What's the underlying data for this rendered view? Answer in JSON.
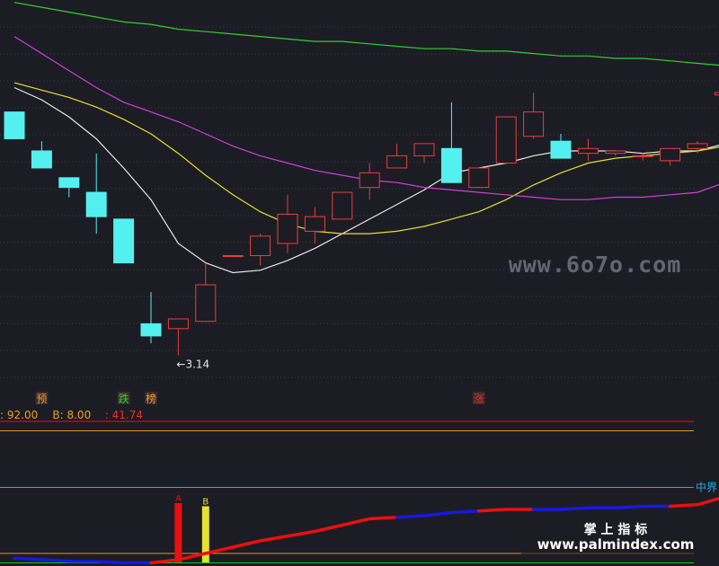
{
  "colors": {
    "background": "#1c1c24",
    "grid": "#3a3a48",
    "up": "#e8403a",
    "down": "#54f0f0",
    "ma_white": "#e8e8e8",
    "ma_yellow": "#e8e030",
    "ma_magenta": "#d040d8",
    "ma_green": "#30d030",
    "indicator_red": "#e81010",
    "indicator_blue": "#1818e0",
    "level_cyan": "#2aa8e8",
    "level_orange": "#e89030",
    "level_green": "#20c020",
    "text_orange": "#e8a030",
    "text_red": "#e83030"
  },
  "chart_data": [
    {
      "type": "candlestick",
      "grid": true,
      "ylim": [
        3.05,
        4.6
      ],
      "candles": [
        {
          "o": 4.14,
          "h": 4.14,
          "l": 4.03,
          "c": 4.03
        },
        {
          "o": 3.98,
          "h": 4.02,
          "l": 3.91,
          "c": 3.91
        },
        {
          "o": 3.87,
          "h": 3.87,
          "l": 3.79,
          "c": 3.83
        },
        {
          "o": 3.81,
          "h": 3.97,
          "l": 3.64,
          "c": 3.71
        },
        {
          "o": 3.7,
          "h": 3.7,
          "l": 3.52,
          "c": 3.52
        },
        {
          "o": 3.27,
          "h": 3.4,
          "l": 3.19,
          "c": 3.22
        },
        {
          "o": 3.25,
          "h": 3.25,
          "l": 3.14,
          "c": 3.29
        },
        {
          "o": 3.28,
          "h": 3.52,
          "l": 3.28,
          "c": 3.43
        },
        {
          "o": 3.55,
          "h": 3.55,
          "l": 3.55,
          "c": 3.55
        },
        {
          "o": 3.55,
          "h": 3.64,
          "l": 3.51,
          "c": 3.63
        },
        {
          "o": 3.6,
          "h": 3.8,
          "l": 3.56,
          "c": 3.72
        },
        {
          "o": 3.65,
          "h": 3.75,
          "l": 3.6,
          "c": 3.71
        },
        {
          "o": 3.7,
          "h": 3.8,
          "l": 3.7,
          "c": 3.81
        },
        {
          "o": 3.83,
          "h": 3.93,
          "l": 3.78,
          "c": 3.89
        },
        {
          "o": 3.91,
          "h": 4.01,
          "l": 3.91,
          "c": 3.96
        },
        {
          "o": 3.96,
          "h": 4.0,
          "l": 3.93,
          "c": 4.01
        },
        {
          "o": 3.99,
          "h": 4.18,
          "l": 3.85,
          "c": 3.85
        },
        {
          "o": 3.83,
          "h": 3.91,
          "l": 3.83,
          "c": 3.91
        },
        {
          "o": 3.93,
          "h": 4.11,
          "l": 3.93,
          "c": 4.12
        },
        {
          "o": 4.04,
          "h": 4.22,
          "l": 4.03,
          "c": 4.14
        },
        {
          "o": 4.02,
          "h": 4.05,
          "l": 3.95,
          "c": 3.95
        },
        {
          "o": 3.97,
          "h": 4.03,
          "l": 3.94,
          "c": 3.99
        },
        {
          "o": 3.97,
          "h": 3.98,
          "l": 3.96,
          "c": 3.98
        },
        {
          "o": 3.96,
          "h": 3.97,
          "l": 3.94,
          "c": 3.96
        },
        {
          "o": 3.94,
          "h": 3.96,
          "l": 3.92,
          "c": 3.99
        },
        {
          "o": 3.99,
          "h": 4.02,
          "l": 3.97,
          "c": 4.01
        },
        {
          "o": 4.21,
          "h": 4.21,
          "l": 4.16,
          "c": 4.22
        }
      ],
      "ma": [
        {
          "color_key": "ma_white",
          "values": [
            4.24,
            4.19,
            4.12,
            4.03,
            3.91,
            3.78,
            3.6,
            3.52,
            3.48,
            3.49,
            3.53,
            3.58,
            3.64,
            3.7,
            3.76,
            3.82,
            3.89,
            3.91,
            3.93,
            3.96,
            3.98,
            3.98,
            3.98,
            3.97,
            3.98,
            3.98,
            4.01
          ]
        },
        {
          "color_key": "ma_yellow",
          "values": [
            4.26,
            4.23,
            4.2,
            4.16,
            4.11,
            4.05,
            3.97,
            3.88,
            3.8,
            3.73,
            3.68,
            3.65,
            3.64,
            3.64,
            3.65,
            3.67,
            3.7,
            3.73,
            3.78,
            3.84,
            3.89,
            3.93,
            3.95,
            3.96,
            3.97,
            3.98,
            4.0
          ]
        },
        {
          "color_key": "ma_magenta",
          "values": [
            4.45,
            4.38,
            4.31,
            4.24,
            4.18,
            4.14,
            4.1,
            4.05,
            4.0,
            3.96,
            3.93,
            3.9,
            3.88,
            3.86,
            3.85,
            3.83,
            3.82,
            3.81,
            3.8,
            3.79,
            3.78,
            3.78,
            3.79,
            3.79,
            3.8,
            3.81,
            3.85
          ]
        },
        {
          "color_key": "ma_green",
          "values": [
            4.59,
            4.57,
            4.55,
            4.53,
            4.51,
            4.5,
            4.48,
            4.47,
            4.46,
            4.45,
            4.44,
            4.43,
            4.43,
            4.42,
            4.41,
            4.4,
            4.4,
            4.39,
            4.39,
            4.38,
            4.37,
            4.37,
            4.36,
            4.36,
            4.35,
            4.34,
            4.33
          ]
        }
      ],
      "annotations": [
        {
          "index": 6,
          "text": "←3.14"
        }
      ],
      "markers": [
        {
          "index": 1,
          "text": "预",
          "color_key": "text_orange"
        },
        {
          "index": 4,
          "text": "跌",
          "color_key": "ma_green"
        },
        {
          "index": 5,
          "text": "榜",
          "color_key": "text_orange"
        },
        {
          "index": 17,
          "text": "涨",
          "color_key": "text_red"
        }
      ]
    },
    {
      "type": "line",
      "grid": false,
      "ylim": [
        0,
        100
      ],
      "legend": {
        "items": [
          {
            "text": ": 92.00",
            "color_key": "text_orange"
          },
          {
            "text": "B: 8.00",
            "color_key": "text_orange"
          },
          {
            "text": ": 41.74",
            "color_key": "text_red"
          }
        ]
      },
      "levels": [
        {
          "value": 92,
          "color_key": "indicator_red",
          "label": ""
        },
        {
          "value": 86,
          "color_key": "level_orange",
          "label": ""
        },
        {
          "value": 50,
          "color_key": "level_cyan",
          "label": "中界"
        },
        {
          "value": 8,
          "color_key": "level_orange",
          "label": ""
        },
        {
          "value": 2,
          "color_key": "level_green",
          "label": ""
        }
      ],
      "series": [
        {
          "values": [
            5,
            4,
            3,
            3,
            2,
            2,
            4,
            8,
            12,
            16,
            19,
            22,
            26,
            30,
            31,
            32,
            34,
            35,
            36,
            36,
            36,
            37,
            37,
            38,
            38,
            39,
            44
          ],
          "segment_colors": [
            "indicator_blue",
            "indicator_blue",
            "indicator_blue",
            "indicator_blue",
            "indicator_blue",
            "indicator_red",
            "indicator_red",
            "indicator_red",
            "indicator_red",
            "indicator_red",
            "indicator_red",
            "indicator_red",
            "indicator_red",
            "indicator_red",
            "indicator_blue",
            "indicator_blue",
            "indicator_blue",
            "indicator_red",
            "indicator_red",
            "indicator_blue",
            "indicator_blue",
            "indicator_blue",
            "indicator_blue",
            "indicator_blue",
            "indicator_red",
            "indicator_red"
          ]
        }
      ],
      "bars": [
        {
          "index": 6,
          "value": 40,
          "color_key": "indicator_red",
          "label": "A"
        },
        {
          "index": 7,
          "value": 38,
          "color_key": "ma_yellow",
          "label": "B"
        }
      ]
    }
  ],
  "watermarks": {
    "primary": "www.6o7o.com",
    "secondary_title": "掌 上 指 标",
    "secondary_url": "www.palmindex.com"
  }
}
